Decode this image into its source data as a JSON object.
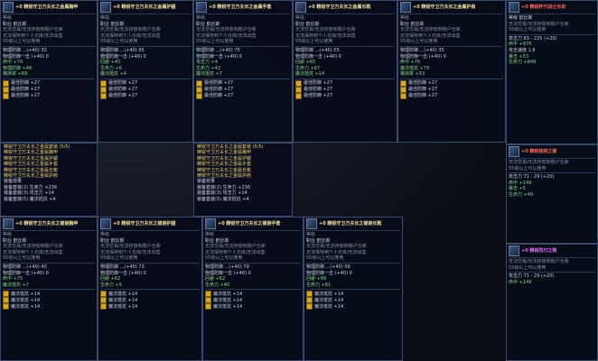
{
  "tooltips": [
    {
      "title": "+0 精锐守卫万夫长之金属胸甲",
      "rows": [
        "等级",
        "职业 欧比斯",
        "无法交易/无法存放到账户仓库",
        "无法保存到个人仓库/无法出售",
        "55级以上可以使用"
      ],
      "stats": [
        "物理防御 ...(+40) 30",
        "物理防御一击 (+40) 0",
        "命中 +74",
        "物理防御 +48",
        "格挡率 +89"
      ],
      "slots": [
        "最佳防御 +27",
        "最佳防御 +27",
        "最佳防御 +27"
      ]
    },
    {
      "title": "+0 精锐守卫万夫长之金属护腿",
      "rows": [
        "等级",
        "职业 欧比斯",
        "无法交易/无法存放到账户仓库",
        "无法保存到个人仓库/无法出售",
        "55级以上可以使用"
      ],
      "stats": [
        "物理防御 ...(+40) 95",
        "物理防御一击 (+40) 0",
        "回避 +45",
        "生命力 +6",
        "魔法抵抗 +4"
      ],
      "slots": [
        "最佳防御 +27",
        "最佳防御 +27",
        "最佳防御 +27"
      ]
    },
    {
      "title": "+0 精锐守卫万夫长之金属手套",
      "rows": [
        "等级",
        "职业 欧比斯",
        "无法交易/无法存放到账户仓库",
        "无法保存到个人仓库/无法出售",
        "55级以上可以使用"
      ],
      "stats": [
        "物理防御 ...(+40) 75",
        "物理防御一击 (+40) 0",
        "攻击力 +4",
        "生命力 +42",
        "魔法抵抗 +7"
      ],
      "slots": [
        "最佳防御 +27",
        "最佳防御 +27",
        "最佳防御 +27"
      ]
    },
    {
      "title": "+0 精锐守卫万夫长之金属长靴",
      "rows": [
        "等级",
        "职业 欧比斯",
        "无法交易/无法存放到账户仓库",
        "无法保存到个人仓库/无法出售",
        "55级以上可以使用"
      ],
      "stats": [
        "物理防御 ...(+40) 55",
        "物理防御一击 (+40) 0",
        "回避 +65",
        "生命力 +87",
        "魔法抵抗 +14"
      ],
      "slots": [
        "最佳防御 +27",
        "最佳防御 +27",
        "最佳防御 +27"
      ]
    },
    {
      "title": "+0 精锐守卫万夫长之金属护肩",
      "rows": [
        "等级",
        "职业 欧比斯",
        "无法交易/无法存放到账户仓库",
        "无法保存到个人仓库/无法出售",
        "55级以上可以使用"
      ],
      "stats": [
        "物理防御 ...(+40) 35",
        "物理防御一击 (+40) 0",
        "命中 +76",
        "魔法抵抗 +79",
        "格挡率 +53"
      ],
      "slots": [
        "最佳防御 +27",
        "最佳防御 +27",
        "最佳防御 +27"
      ]
    },
    {
      "title": "+0 精锐守卫万夫长之锁链胸甲",
      "rows": [
        "等级",
        "职业 欧比斯",
        "无法交易/无法存放到账户仓库",
        "无法保存到个人仓库/无法出售",
        "55级以上可以使用"
      ],
      "stats": [
        "物理防御 ...(+40) 40",
        "物理防御一击 (+40) 0",
        "命中 +75",
        "魔法抵抗 +7"
      ],
      "slots": [
        "魔法抵抗 +14",
        "魔法抵抗 +14",
        "魔法抵抗 +14"
      ]
    },
    {
      "title": "+0 精锐守卫万夫长之锁链护腿",
      "rows": [
        "等级",
        "职业 欧比斯",
        "无法交易/无法存放到账户仓库",
        "无法保存到个人仓库/无法出售",
        "55级以上可以使用"
      ],
      "stats": [
        "物理防御 ...(+40) 73",
        "物理防御一击 (+40) 0",
        "回避 +62",
        "生命力 +5"
      ],
      "slots": [
        "魔法抵抗 +14",
        "魔法抵抗 +14",
        "魔法抵抗 +14"
      ]
    },
    {
      "title": "+0 精锐守卫万夫长之锁链手套",
      "rows": [
        "等级",
        "职业 欧比斯",
        "无法交易/无法存放到账户仓库",
        "无法保存到个人仓库/无法出售",
        "55级以上可以使用"
      ],
      "stats": [
        "物理防御 ...(+40) 79",
        "物理防御一击 (+40) 0",
        "回避 +62",
        "生命力 +40"
      ],
      "slots": [
        "魔法抵抗 +14",
        "魔法抵抗 +14",
        "魔法抵抗 +14"
      ]
    },
    {
      "title": "+0 精锐守卫万夫长之锁链长靴",
      "rows": [
        "等级",
        "职业 欧比斯",
        "无法交易/无法存放到账户仓库",
        "无法保存到个人仓库/无法出售",
        "55级以上可以使用"
      ],
      "stats": [
        "物理防御 ...(+40) 56",
        "物理防御一击 (+40) 0",
        "回避 +88",
        "生命力 +81"
      ],
      "slots": [
        "魔法抵抗 +14",
        "魔法抵抗 +14",
        "魔法抵抗 +14"
      ]
    }
  ],
  "sets": [
    {
      "title": "精锐守卫万夫长之金属套装 (5/5)",
      "items": [
        "精锐守卫万夫长之金属胸甲",
        "精锐守卫万夫长之金属护腿",
        "精锐守卫万夫长之金属手套",
        "精锐守卫万夫长之金属长靴",
        "精锐守卫万夫长之金属护肩"
      ],
      "bonus_label": "装备效果",
      "bonus": [
        "装备套装(2) 生命力 +236",
        "装备套装(3) 攻击力 +14",
        "装备套装(5) 魔法抵抗 +4"
      ]
    },
    {
      "title": "精锐守卫万夫长之金属套装 (5/5)",
      "items": [
        "精锐守卫万夫长之金属胸甲",
        "精锐守卫万夫长之金属护腿",
        "精锐守卫万夫长之金属手套",
        "精锐守卫万夫长之金属长靴",
        "精锐守卫万夫长之金属护肩"
      ],
      "bonus_label": "装备效果",
      "bonus": [
        "装备套装(2) 生命力 +236",
        "装备套装(3) 攻击力 +14",
        "装备套装(5) 魔法抵抗 +4"
      ]
    }
  ],
  "right_panel": {
    "title": "+0 精锐杯刃战士长剑",
    "lines": [
      "等级 欧比斯",
      "无法交易/无法存放到账户仓库",
      "55级以上可以使用",
      "攻击力 83 - 225 (+20)",
      "命中 +976",
      "攻击速度 1.6",
      "暴击 +53",
      "生命力 +849"
    ],
    "title2": "+0 精锐铭刻之锁",
    "lines2": [
      "无法交易/无法存放到账户仓库",
      "55级以上可以使用",
      "攻击力 71 - 29 (+20)",
      "命中 +149",
      "暴击 +5",
      "生命力 +49"
    ],
    "title3": "+0 精锐烈刃之戟",
    "lines3": [
      "无法交易/无法存放到账户仓库",
      "55级以上可以使用",
      "攻击力 71 - 29 (+20)",
      "命中 +149"
    ]
  },
  "colors": {
    "border": "#3a4a6a",
    "title": "#f0e0a0",
    "green": "#8ad48a",
    "gold": "#e8d070"
  }
}
